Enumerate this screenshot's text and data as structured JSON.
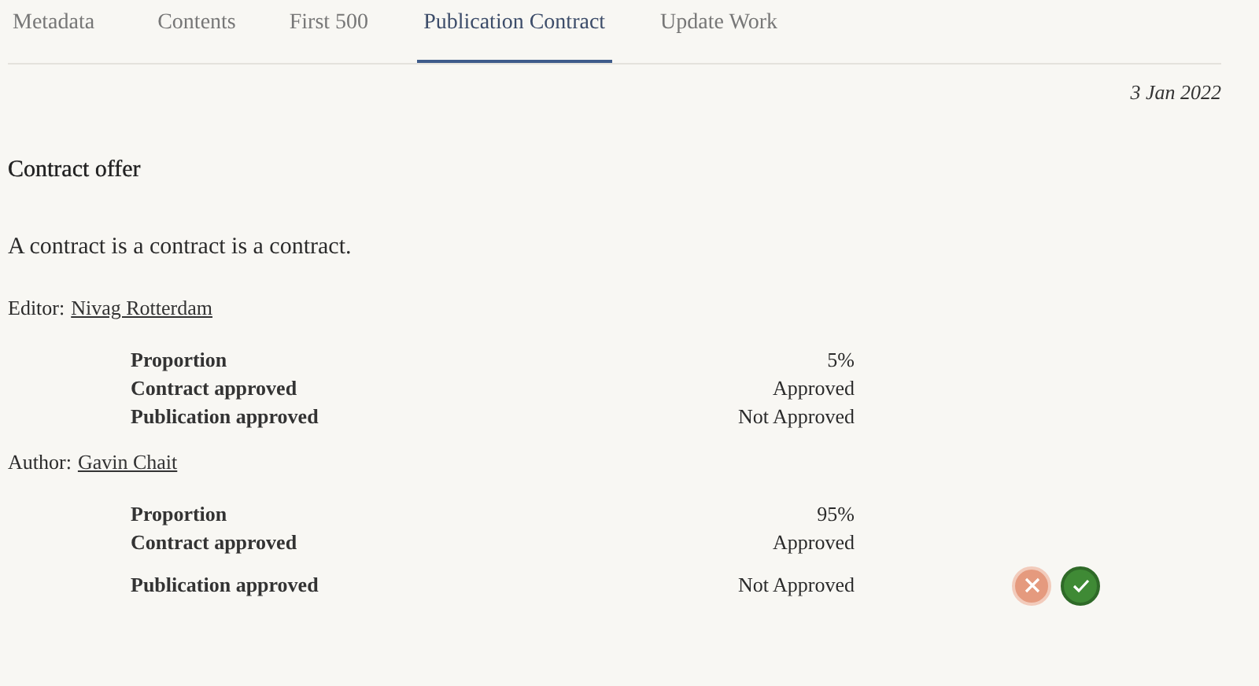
{
  "tabs": [
    {
      "label": "Metadata",
      "selected": false
    },
    {
      "label": "Contents",
      "selected": false
    },
    {
      "label": "First 500",
      "selected": false
    },
    {
      "label": "Publication Contract",
      "selected": true
    },
    {
      "label": "Update Work",
      "selected": false
    }
  ],
  "date": "3 Jan 2022",
  "heading": "Contract offer",
  "description": "A contract is a contract is a contract.",
  "parties": [
    {
      "role": "Editor:",
      "name": "Nivag Rotterdam",
      "rows": [
        {
          "kind": "plain",
          "label": "Proportion",
          "value": "5%"
        },
        {
          "kind": "plain",
          "label": "Contract approved",
          "value": "Approved"
        },
        {
          "kind": "plain",
          "label": "Publication approved",
          "value": "Not Approved"
        }
      ]
    },
    {
      "role": "Author:",
      "name": "Gavin Chait",
      "rows": [
        {
          "kind": "plain",
          "label": "Proportion",
          "value": "95%"
        },
        {
          "kind": "plain",
          "label": "Contract approved",
          "value": "Approved"
        },
        {
          "kind": "decision",
          "label": "Publication approved",
          "value": "Not Approved"
        }
      ]
    }
  ]
}
